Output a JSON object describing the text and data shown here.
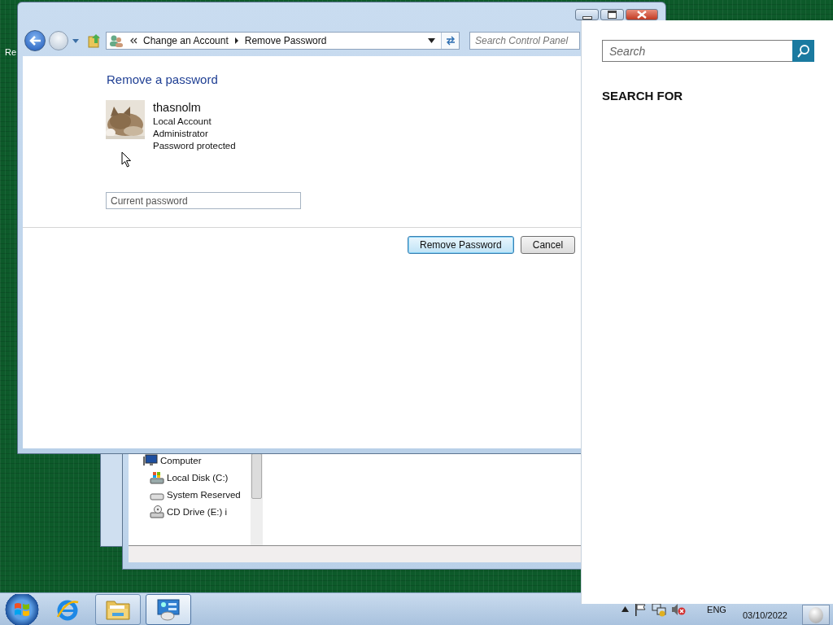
{
  "desktop": {
    "icon_label": "Re"
  },
  "main_window": {
    "address_path": [
      "Change an Account",
      "Remove Password"
    ],
    "search": {
      "placeholder": "Search Control Panel"
    },
    "heading": "Remove a password",
    "account": {
      "name": "thasnolm",
      "details": [
        "Local Account",
        "Administrator",
        "Password protected"
      ]
    },
    "password_field": {
      "placeholder": "Current password"
    },
    "buttons": [
      {
        "label": "Remove Password",
        "default": true
      },
      {
        "label": "Cancel",
        "default": false
      }
    ]
  },
  "explorer_window": {
    "tree": [
      {
        "label": "Computer",
        "kind": "computer",
        "children": [
          {
            "label": "Local Disk (C:)",
            "kind": "system-drive"
          },
          {
            "label": "System Reserved",
            "kind": "drive"
          },
          {
            "label": "CD Drive (E:) i",
            "kind": "cd-drive"
          }
        ]
      }
    ]
  },
  "taskbar": {
    "apps": [
      {
        "kind": "browser",
        "running": false,
        "selected": false
      },
      {
        "kind": "folder",
        "running": true,
        "selected": false
      },
      {
        "kind": "control-panel",
        "running": true,
        "selected": true
      }
    ],
    "language": "ENG",
    "date": "03/10/2022"
  },
  "search_pane": {
    "placeholder": "Search",
    "heading": "SEARCH FOR"
  }
}
